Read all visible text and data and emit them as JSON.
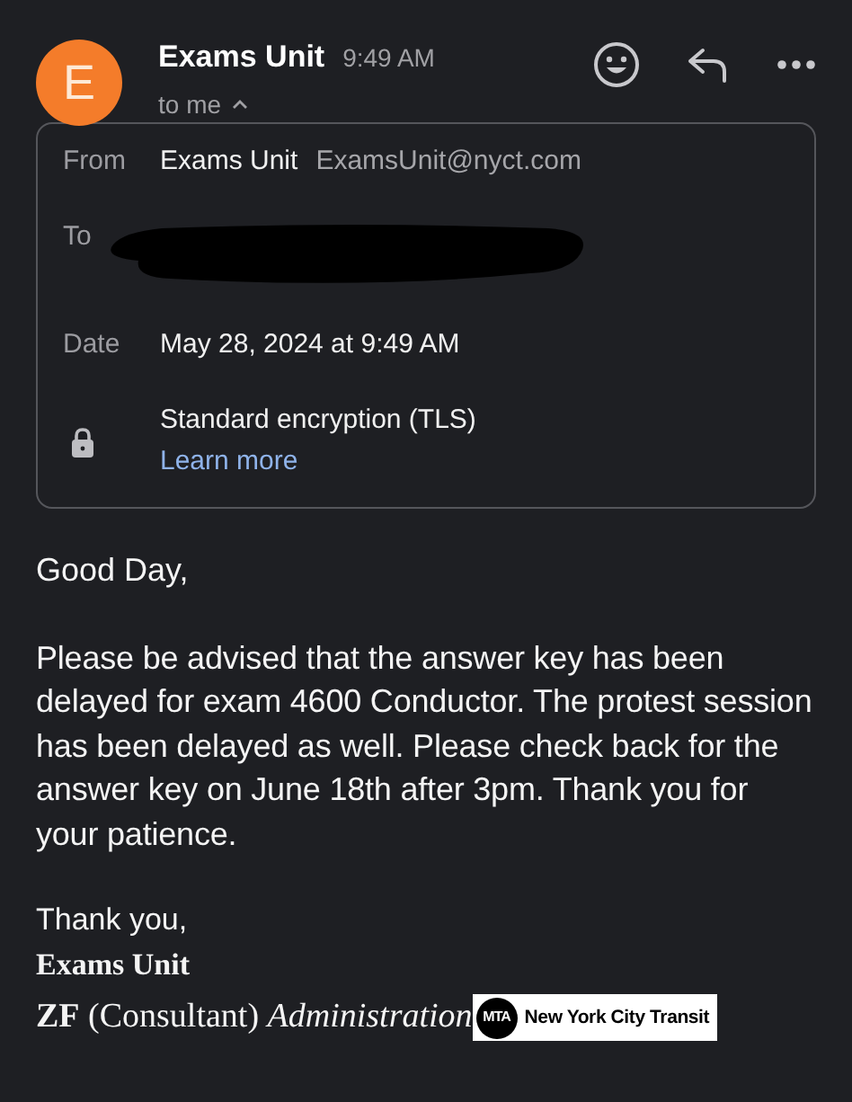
{
  "header": {
    "avatar_letter": "E",
    "sender": "Exams Unit",
    "time": "9:49 AM",
    "recipient": "to me",
    "details_expanded": true
  },
  "details": {
    "rows": [
      {
        "label": "From",
        "kind": "sender",
        "name": "Exams Unit",
        "address": "ExamsUnit@nyct.com"
      },
      {
        "label": "To",
        "kind": "redacted"
      },
      {
        "label": "Date",
        "kind": "text",
        "value": "May 28, 2024 at 9:49 AM"
      }
    ],
    "encryption": {
      "text": "Standard encryption (TLS)",
      "link": "Learn more"
    }
  },
  "body": {
    "greeting": "Good Day,",
    "paragraph": "Please be advised that the answer key has been delayed for exam 4600 Conductor. The protest session has been delayed as well. Please check back for the answer key on June 18th after 3pm. Thank you for your patience.",
    "closing": "Thank you,",
    "signature_name": "Exams Unit",
    "signature_line": "**ZF** (Consultant) *Administration*",
    "logo": {
      "mark": "MTA",
      "text": "New York City Transit"
    }
  }
}
